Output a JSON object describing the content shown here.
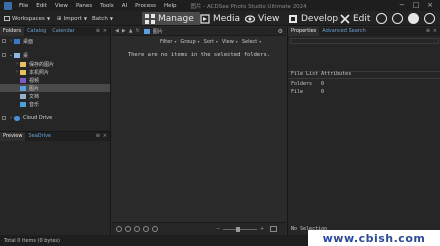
{
  "titlebar": {
    "menus": [
      "File",
      "Edit",
      "View",
      "Panes",
      "Tools",
      "AI",
      "Process",
      "Help"
    ],
    "title": "图片 - ACDSee Photo Studio Ultimate 2024"
  },
  "toolbar": {
    "workspaces": "Workspaces",
    "import": "Import",
    "batch": "Batch",
    "modes": [
      "Manage",
      "Media",
      "View",
      "Develop",
      "Edit"
    ]
  },
  "left_panel": {
    "tabs": [
      "Folders",
      "Catalog",
      "Calendar"
    ],
    "tree": [
      {
        "label": "桌面",
        "level": 0
      },
      {
        "label": "桌",
        "level": 0
      },
      {
        "label": "保存的图片",
        "level": 1
      },
      {
        "label": "本机照片",
        "level": 1
      },
      {
        "label": "视频",
        "level": 1
      },
      {
        "label": "图片",
        "level": 1
      },
      {
        "label": "文档",
        "level": 1
      },
      {
        "label": "音乐",
        "level": 1
      },
      {
        "label": "Cloud Drive",
        "level": 0
      }
    ]
  },
  "preview_panel": {
    "tabs": [
      "Preview",
      "SeaDrive"
    ]
  },
  "center": {
    "breadcrumb": "图片",
    "filters": [
      "Filter",
      "Group",
      "Sort",
      "View",
      "Select"
    ],
    "empty_message": "There are no items in the selected folders."
  },
  "right_panel": {
    "tabs": [
      "Properties",
      "Advanced Search"
    ],
    "section_title": "File List Attributes",
    "attributes": [
      {
        "label": "Folders",
        "value": "0"
      },
      {
        "label": "File",
        "value": "0"
      }
    ],
    "selection": "No Selection"
  },
  "statusbar": {
    "text": "Total 0 items  (0 bytes)"
  },
  "watermark": "www.cbish.com"
}
